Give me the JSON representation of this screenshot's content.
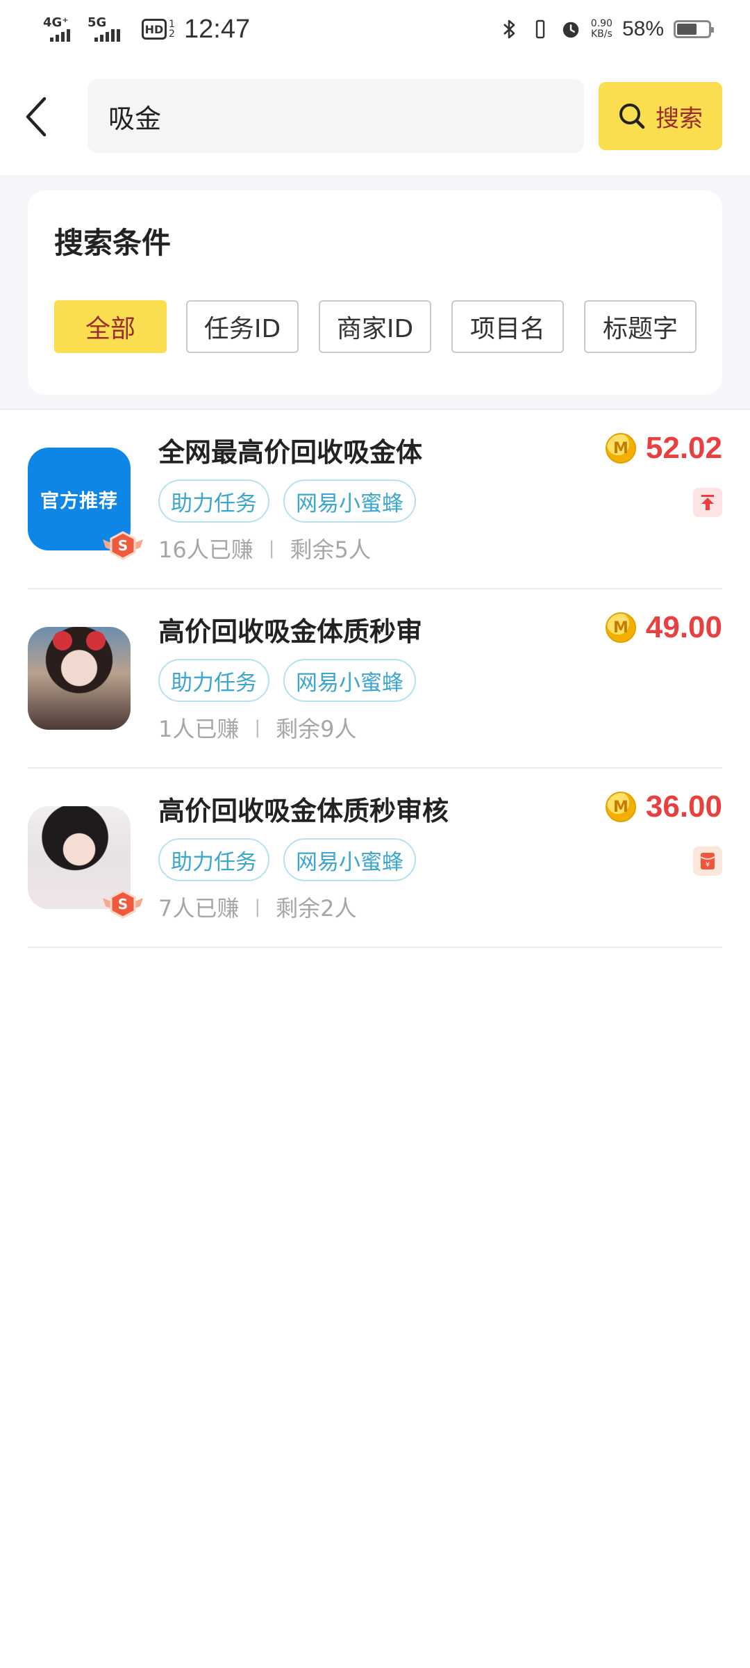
{
  "status_bar": {
    "net1": "4G⁺",
    "net2": "5G",
    "hd": "HD",
    "hd_sub": "1 2",
    "time": "12:47",
    "speed_value": "0.90",
    "speed_unit": "KB/s",
    "battery_pct": "58%",
    "battery_level": 0.58,
    "icons": [
      "bluetooth-icon",
      "vibrate-icon",
      "alarm-icon",
      "battery-icon"
    ]
  },
  "search": {
    "query": "吸金",
    "button_label": "搜索",
    "accent_color": "#fbde4f"
  },
  "filters": {
    "title": "搜索条件",
    "options": [
      "全部",
      "任务ID",
      "商家ID",
      "项目名",
      "标题字"
    ],
    "selected": "全部"
  },
  "tasks": [
    {
      "thumb_label": "官方推荐",
      "title": "全网最高价回收吸金体",
      "tags": [
        "助力任务",
        "网易小蜜蜂"
      ],
      "earned": "16人已赚",
      "remaining": "剩余5人",
      "price": "52.02",
      "coin_letter": "M",
      "badge_letter": "S",
      "side_icon": "pin-top-icon"
    },
    {
      "title": "高价回收吸金体质秒审",
      "tags": [
        "助力任务",
        "网易小蜜蜂"
      ],
      "earned": "1人已赚",
      "remaining": "剩余9人",
      "price": "49.00",
      "coin_letter": "M"
    },
    {
      "title": "高价回收吸金体质秒审核",
      "tags": [
        "助力任务",
        "网易小蜜蜂"
      ],
      "earned": "7人已赚",
      "remaining": "剩余2人",
      "price": "36.00",
      "coin_letter": "M",
      "badge_letter": "S",
      "side_icon": "red-envelope-icon",
      "side_icon_glyph": "¥"
    }
  ],
  "meta_separator": "|",
  "colors": {
    "price": "#e8403f",
    "tag_text": "#3ca6cf",
    "tag_border": "#b6e1f1"
  }
}
